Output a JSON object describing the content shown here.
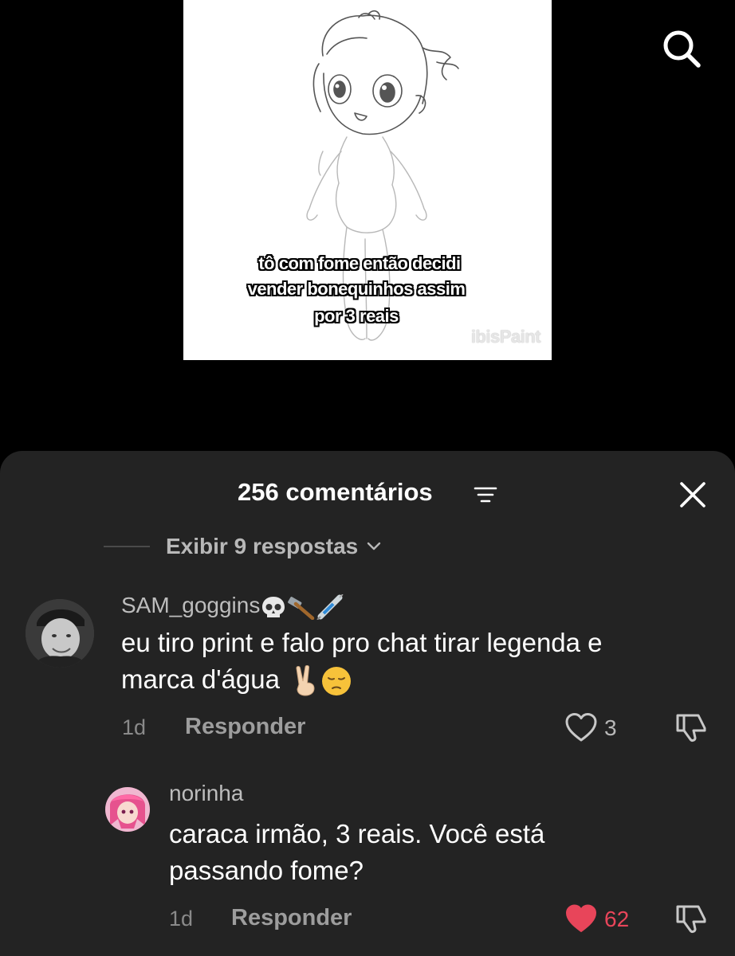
{
  "video": {
    "caption_lines": [
      "tô com fome então decidi",
      "vender bonequinhos assim",
      "por 3 reais"
    ],
    "watermark": "ibisPaint",
    "search_icon": "search-icon"
  },
  "comments_sheet": {
    "title": "256 comentários",
    "filter_icon": "filter-icon",
    "close_icon": "close-icon",
    "view_replies_label": "Exibir 9 respostas",
    "comments": [
      {
        "username": "SAM_goggins",
        "username_emojis": [
          "skull-emoji",
          "hammer-emoji",
          "syringe-emoji"
        ],
        "text_line1": "eu tiro print e falo pro chat tirar legenda e",
        "text_line2": "marca d'água",
        "text_emojis": [
          "victory-hand-emoji",
          "pensive-face-emoji"
        ],
        "time": "1d",
        "reply_label": "Responder",
        "likes": "3",
        "liked": false
      },
      {
        "username": "norinha",
        "text_line1": "caraca irmão, 3 reais. Você está",
        "text_line2": "passando fome?",
        "time": "1d",
        "reply_label": "Responder",
        "likes": "62",
        "liked": true
      }
    ]
  },
  "colors": {
    "background": "#000000",
    "sheet": "#232323",
    "like_active": "#e8455a",
    "secondary_text": "#b8b8b8"
  }
}
